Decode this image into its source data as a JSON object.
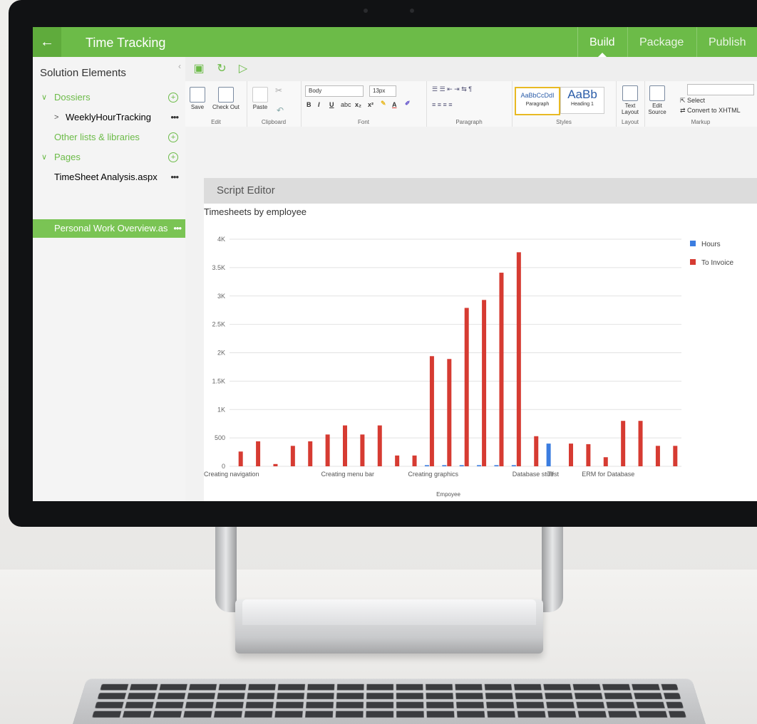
{
  "app": {
    "back_icon": "←",
    "title": "Time Tracking",
    "tabs": [
      {
        "label": "Build",
        "active": true
      },
      {
        "label": "Package",
        "active": false
      },
      {
        "label": "Publish",
        "active": false
      }
    ]
  },
  "sidebar": {
    "heading": "Solution Elements",
    "collapse_icon": "‹",
    "rows": [
      {
        "label": "Dossiers",
        "kind": "section"
      },
      {
        "label": "WeeklyHourTracking",
        "kind": "item"
      },
      {
        "label": "Other lists & libraries",
        "kind": "section"
      },
      {
        "label": "Pages",
        "kind": "section"
      },
      {
        "label": "TimeSheet Analysis.aspx",
        "kind": "item"
      },
      {
        "label": "Personal Work Overview.as",
        "kind": "item-selected"
      }
    ]
  },
  "ribbon": {
    "save": "Save",
    "checkout": "Check Out",
    "paste": "Paste",
    "font_name": "Body",
    "font_size": "13px",
    "style_normal_sample": "AaBbCcDdI",
    "style_normal": "Paragraph",
    "style_h1_sample": "AaBb",
    "style_h1": "Heading 1",
    "text_layout": "Text Layout",
    "edit_source": "Edit Source",
    "select": "Select",
    "convert": "Convert to XHTML",
    "groups": {
      "edit": "Edit",
      "clipboard": "Clipboard",
      "font": "Font",
      "paragraph": "Paragraph",
      "styles": "Styles",
      "layout": "Layout",
      "markup": "Markup"
    }
  },
  "webpart": {
    "title": "Script Editor"
  },
  "chart_data": {
    "type": "bar",
    "title": "Timesheets by employee",
    "xlabel": "Empoyee",
    "ylabel": "",
    "ylim": [
      0,
      4000
    ],
    "y_ticks": [
      "0",
      "500",
      "1K",
      "1.5K",
      "2K",
      "2.5K",
      "3K",
      "3.5K",
      "4K"
    ],
    "x_tick_labels": [
      "Creating navigation",
      "Creating menu bar",
      "Creating graphics",
      "Database stuff",
      "Test",
      "ERM for Database"
    ],
    "legend_position": "top-right",
    "series": [
      {
        "name": "Hours",
        "color": "#3b7de0",
        "values": [
          0,
          0,
          0,
          0,
          0,
          0,
          0,
          0,
          0,
          0,
          0,
          20,
          20,
          20,
          20,
          20,
          20,
          0,
          400,
          0,
          0,
          0,
          0,
          0,
          0,
          0
        ]
      },
      {
        "name": "To Invoice",
        "color": "#d63b32",
        "values": [
          260,
          440,
          40,
          360,
          440,
          560,
          720,
          560,
          720,
          190,
          190,
          1940,
          1890,
          2790,
          2930,
          3410,
          3770,
          530,
          0,
          400,
          390,
          160,
          800,
          800,
          360,
          360
        ]
      }
    ]
  }
}
